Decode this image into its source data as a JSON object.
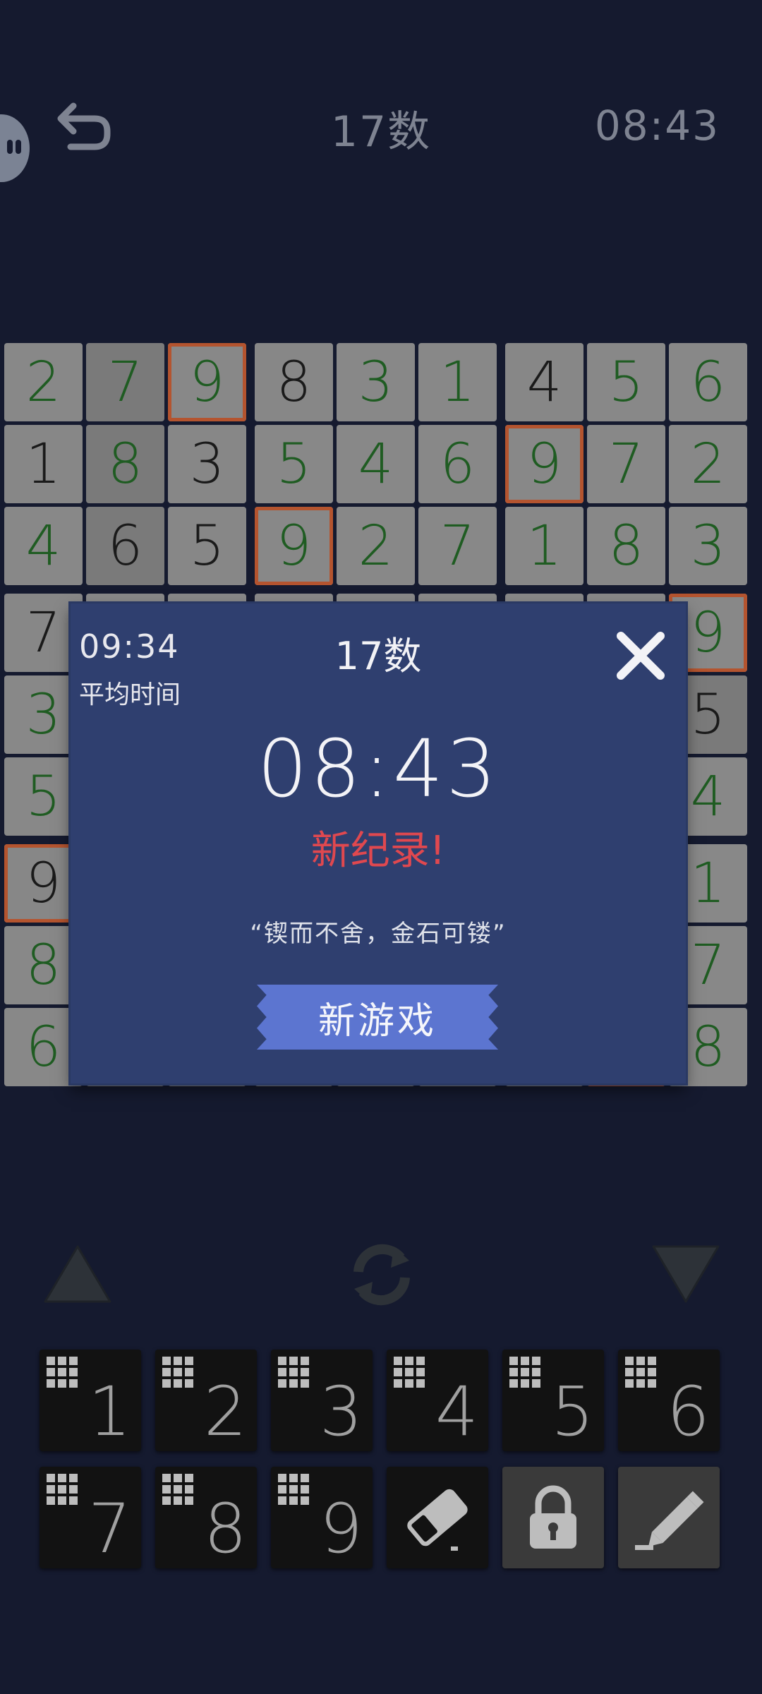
{
  "header": {
    "title": "17数",
    "timer": "08:43"
  },
  "board": [
    [
      {
        "v": "2",
        "t": "user"
      },
      {
        "v": "7",
        "t": "user",
        "dark": true
      },
      {
        "v": "9",
        "t": "user",
        "hl": true
      },
      {
        "v": "8",
        "t": "given"
      },
      {
        "v": "3",
        "t": "user"
      },
      {
        "v": "1",
        "t": "user"
      },
      {
        "v": "4",
        "t": "given"
      },
      {
        "v": "5",
        "t": "user"
      },
      {
        "v": "6",
        "t": "user"
      }
    ],
    [
      {
        "v": "1",
        "t": "given"
      },
      {
        "v": "8",
        "t": "user",
        "dark": true
      },
      {
        "v": "3",
        "t": "given"
      },
      {
        "v": "5",
        "t": "user"
      },
      {
        "v": "4",
        "t": "user"
      },
      {
        "v": "6",
        "t": "user"
      },
      {
        "v": "9",
        "t": "user",
        "hl": true
      },
      {
        "v": "7",
        "t": "user"
      },
      {
        "v": "2",
        "t": "user"
      }
    ],
    [
      {
        "v": "4",
        "t": "user"
      },
      {
        "v": "6",
        "t": "given",
        "dark": true
      },
      {
        "v": "5",
        "t": "given"
      },
      {
        "v": "9",
        "t": "user",
        "hl": true
      },
      {
        "v": "2",
        "t": "user"
      },
      {
        "v": "7",
        "t": "user"
      },
      {
        "v": "1",
        "t": "user"
      },
      {
        "v": "8",
        "t": "user"
      },
      {
        "v": "3",
        "t": "user"
      }
    ],
    [
      {
        "v": "7",
        "t": "given"
      },
      {
        "v": "",
        "t": "user"
      },
      {
        "v": "",
        "t": "user"
      },
      {
        "v": "",
        "t": "user"
      },
      {
        "v": "",
        "t": "user"
      },
      {
        "v": "",
        "t": "user"
      },
      {
        "v": "",
        "t": "user"
      },
      {
        "v": "",
        "t": "user"
      },
      {
        "v": "9",
        "t": "user",
        "hl": true
      }
    ],
    [
      {
        "v": "3",
        "t": "user"
      },
      {
        "v": "",
        "t": "user"
      },
      {
        "v": "",
        "t": "user"
      },
      {
        "v": "",
        "t": "user"
      },
      {
        "v": "",
        "t": "user"
      },
      {
        "v": "",
        "t": "user"
      },
      {
        "v": "",
        "t": "user"
      },
      {
        "v": "",
        "t": "user"
      },
      {
        "v": "5",
        "t": "given",
        "dark": true
      }
    ],
    [
      {
        "v": "5",
        "t": "user"
      },
      {
        "v": "",
        "t": "user"
      },
      {
        "v": "",
        "t": "user"
      },
      {
        "v": "",
        "t": "user"
      },
      {
        "v": "",
        "t": "user"
      },
      {
        "v": "",
        "t": "user"
      },
      {
        "v": "",
        "t": "user"
      },
      {
        "v": "",
        "t": "user"
      },
      {
        "v": "4",
        "t": "user"
      }
    ],
    [
      {
        "v": "9",
        "t": "given",
        "hl": true
      },
      {
        "v": "",
        "t": "user"
      },
      {
        "v": "",
        "t": "user"
      },
      {
        "v": "",
        "t": "user"
      },
      {
        "v": "",
        "t": "user"
      },
      {
        "v": "",
        "t": "user"
      },
      {
        "v": "",
        "t": "user"
      },
      {
        "v": "",
        "t": "user"
      },
      {
        "v": "1",
        "t": "user"
      }
    ],
    [
      {
        "v": "8",
        "t": "user"
      },
      {
        "v": "",
        "t": "user"
      },
      {
        "v": "",
        "t": "user"
      },
      {
        "v": "",
        "t": "user"
      },
      {
        "v": "",
        "t": "user"
      },
      {
        "v": "",
        "t": "user"
      },
      {
        "v": "",
        "t": "user"
      },
      {
        "v": "",
        "t": "user"
      },
      {
        "v": "7",
        "t": "user"
      }
    ],
    [
      {
        "v": "6",
        "t": "user"
      },
      {
        "v": "",
        "t": "user"
      },
      {
        "v": "",
        "t": "user"
      },
      {
        "v": "",
        "t": "user"
      },
      {
        "v": "",
        "t": "user"
      },
      {
        "v": "",
        "t": "user"
      },
      {
        "v": "",
        "t": "user"
      },
      {
        "v": "",
        "t": "user",
        "hl": true
      },
      {
        "v": "8",
        "t": "user"
      }
    ]
  ],
  "modal": {
    "avg_time": "09:34",
    "avg_label": "平均时间",
    "title": "17数",
    "time": "08:43",
    "record": "新纪录!",
    "quote": "“锲而不舍，金石可镂”",
    "new_game_label": "新游戏"
  },
  "keypad": {
    "numbers": [
      "1",
      "2",
      "3",
      "4",
      "5",
      "6",
      "7",
      "8",
      "9"
    ],
    "tools": [
      "eraser-icon",
      "lock-icon",
      "pencil-icon"
    ]
  },
  "colors": {
    "background": "#151a2f",
    "cell": "#888888",
    "user_digit": "#1f5c22",
    "highlight": "#b4542f",
    "modal": "#2f3f6f",
    "record": "#e0484f",
    "button": "#5c75d0"
  }
}
